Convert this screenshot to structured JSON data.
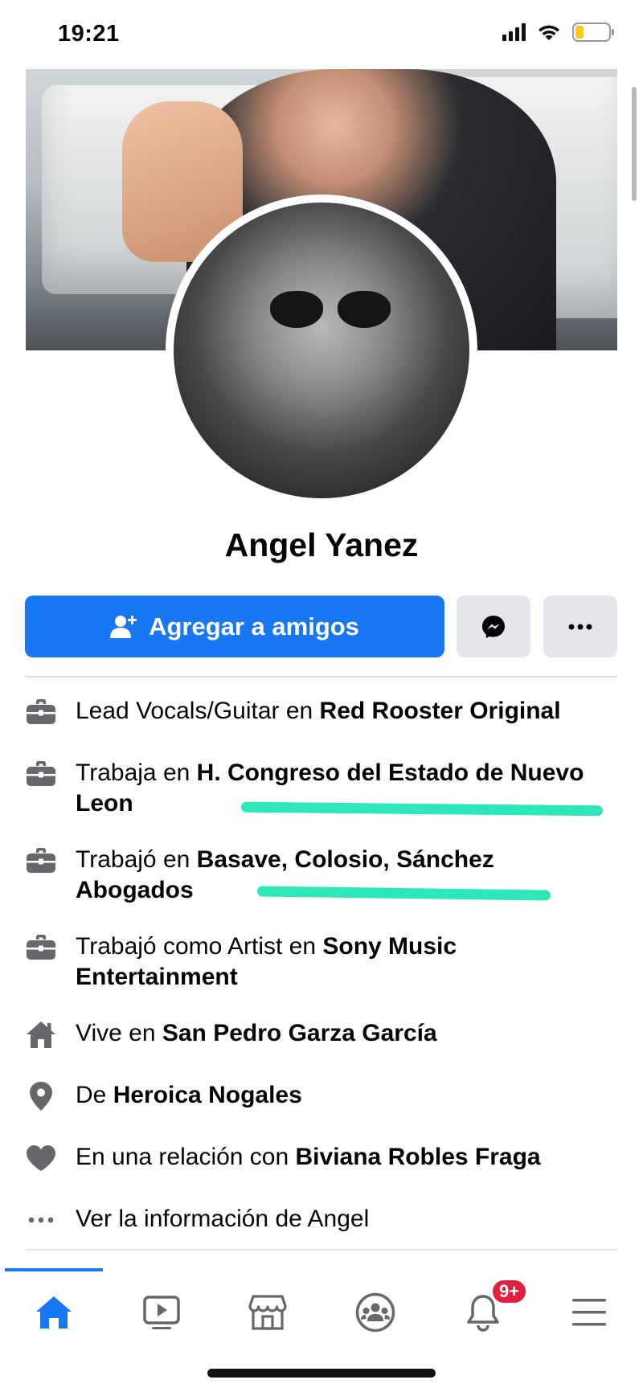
{
  "status_bar": {
    "time": "19:21",
    "battery_level": 0.25,
    "battery_color": "#f5cc1d"
  },
  "profile": {
    "name": "Angel Yanez",
    "add_friend_label": "Agregar a amigos"
  },
  "details": [
    {
      "icon": "briefcase-icon",
      "prefix": "Lead Vocals/Guitar en ",
      "value": "Red Rooster Original",
      "suffix": ""
    },
    {
      "icon": "briefcase-icon",
      "prefix": "Trabaja en ",
      "value": "H. Congreso del Estado de Nuevo Leon",
      "suffix": ""
    },
    {
      "icon": "briefcase-icon",
      "prefix": "Trabajó en ",
      "value": "Basave, Colosio, Sánchez Abogados",
      "suffix": ""
    },
    {
      "icon": "briefcase-icon",
      "prefix": "Trabajó como Artist en ",
      "value": "Sony Music Entertainment",
      "suffix": ""
    },
    {
      "icon": "house-icon",
      "prefix": "Vive en ",
      "value": "San Pedro Garza García",
      "suffix": ""
    },
    {
      "icon": "location-pin-icon",
      "prefix": "De ",
      "value": "Heroica Nogales",
      "suffix": ""
    },
    {
      "icon": "heart-icon",
      "prefix": "En una relación con ",
      "value": "Biviana Robles Fraga",
      "suffix": ""
    },
    {
      "icon": "ellipsis-icon",
      "prefix": "Ver la información de Angel",
      "value": "",
      "suffix": ""
    }
  ],
  "tab_bar": {
    "tabs": [
      "home-icon",
      "video-icon",
      "marketplace-icon",
      "groups-icon",
      "notifications-icon",
      "menu-icon"
    ],
    "active": "home-icon",
    "notifications_badge": "9+"
  },
  "colors": {
    "accent": "#1877f2",
    "highlight": "#22e6b7",
    "badge": "#e41e3f",
    "icon_gray": "#65676b"
  }
}
